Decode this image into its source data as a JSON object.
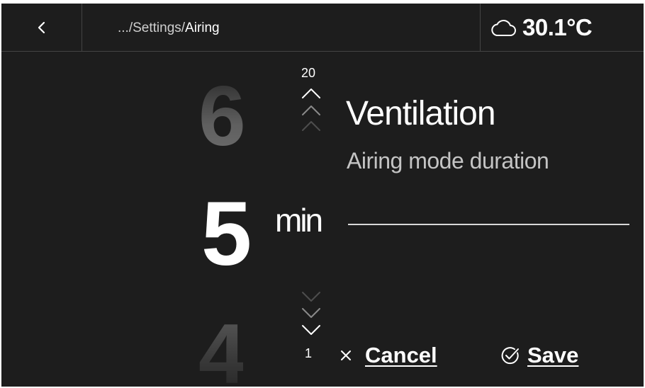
{
  "header": {
    "back_icon": "chevron-left-icon",
    "breadcrumb": {
      "prefix": ".../Settings/",
      "current": "Airing"
    },
    "weather": {
      "icon": "cloud-icon",
      "temperature": "30.1°C"
    }
  },
  "picker": {
    "previous_value": "6",
    "current_value": "5",
    "next_value": "4",
    "unit": "min",
    "max": "20",
    "min": "1",
    "increase_icon": "chevrons-up-icon",
    "decrease_icon": "chevrons-down-icon"
  },
  "setting": {
    "title": "Ventilation",
    "subtitle": "Airing mode duration"
  },
  "actions": {
    "cancel_label": "Cancel",
    "cancel_icon": "close-icon",
    "save_label": "Save",
    "save_icon": "check-circle-icon"
  },
  "colors": {
    "background": "#1d1d1d",
    "text": "#ffffff",
    "muted_text": "#c4c4c4",
    "divider": "#444444"
  }
}
